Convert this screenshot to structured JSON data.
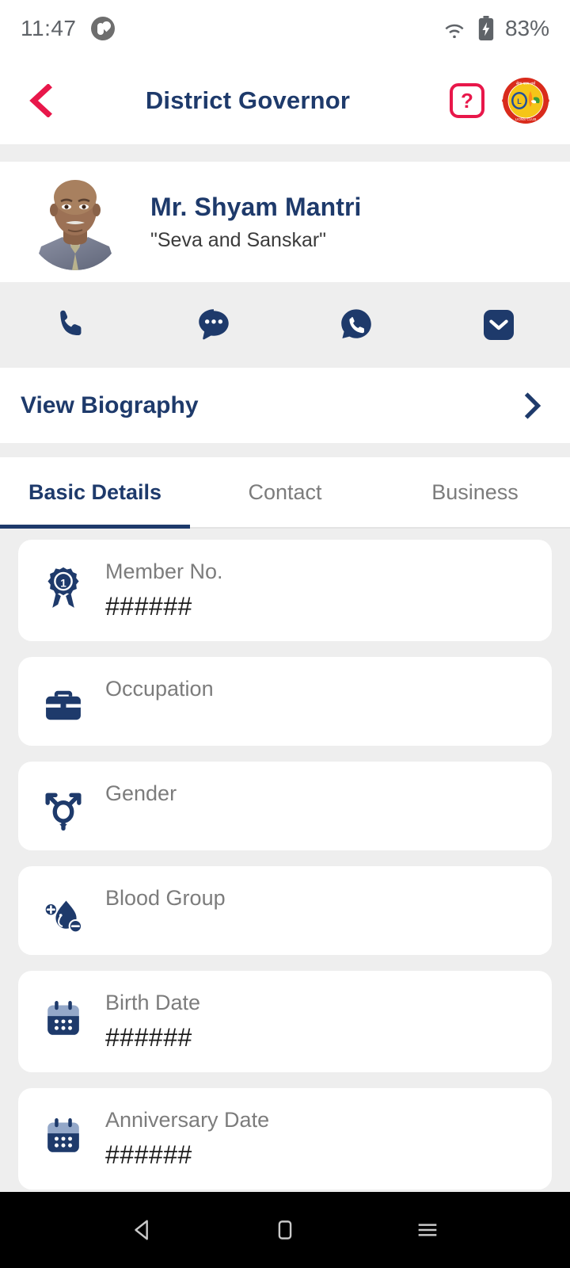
{
  "statusbar": {
    "time": "11:47",
    "battery": "83%",
    "app_icon": "app-notification-icon",
    "wifi_icon": "wifi-icon",
    "battery_icon": "battery-charging-icon"
  },
  "appbar": {
    "back_icon": "back-chevron-icon",
    "title": "District Governor",
    "help_label": "?",
    "help_icon": "help-question-icon",
    "logo_icon": "lions-club-logo"
  },
  "profile": {
    "avatar_icon": "profile-photo",
    "name": "Mr. Shyam Mantri",
    "tagline": "\"Seva and Sanskar\""
  },
  "actions": [
    {
      "name": "call-action",
      "icon": "phone-icon"
    },
    {
      "name": "sms-action",
      "icon": "chat-bubble-icon"
    },
    {
      "name": "whatsapp-action",
      "icon": "whatsapp-icon"
    },
    {
      "name": "email-action",
      "icon": "envelope-icon"
    }
  ],
  "biography": {
    "label": "View Biography",
    "chevron_icon": "chevron-right-icon"
  },
  "tabs": [
    {
      "label": "Basic Details",
      "active": true
    },
    {
      "label": "Contact",
      "active": false
    },
    {
      "label": "Business",
      "active": false
    }
  ],
  "details": [
    {
      "label": "Member No.",
      "value": "######",
      "icon": "award-ribbon-icon"
    },
    {
      "label": "Occupation",
      "value": "",
      "icon": "briefcase-icon"
    },
    {
      "label": "Gender",
      "value": "",
      "icon": "gender-icon"
    },
    {
      "label": "Blood Group",
      "value": "",
      "icon": "blood-drop-icon"
    },
    {
      "label": "Birth Date",
      "value": "######",
      "icon": "calendar-icon"
    },
    {
      "label": "Anniversary Date",
      "value": "######",
      "icon": "calendar-icon"
    }
  ],
  "navbar": [
    {
      "name": "android-back-button",
      "icon": "triangle-back-icon"
    },
    {
      "name": "android-home-button",
      "icon": "square-home-icon"
    },
    {
      "name": "android-recents-button",
      "icon": "hamburger-recents-icon"
    }
  ],
  "colors": {
    "primary_navy": "#1e3a6b",
    "accent_red": "#e8174a",
    "page_bg": "#eeeeee",
    "card_bg": "#ffffff",
    "label_gray": "#7c7c7c"
  }
}
